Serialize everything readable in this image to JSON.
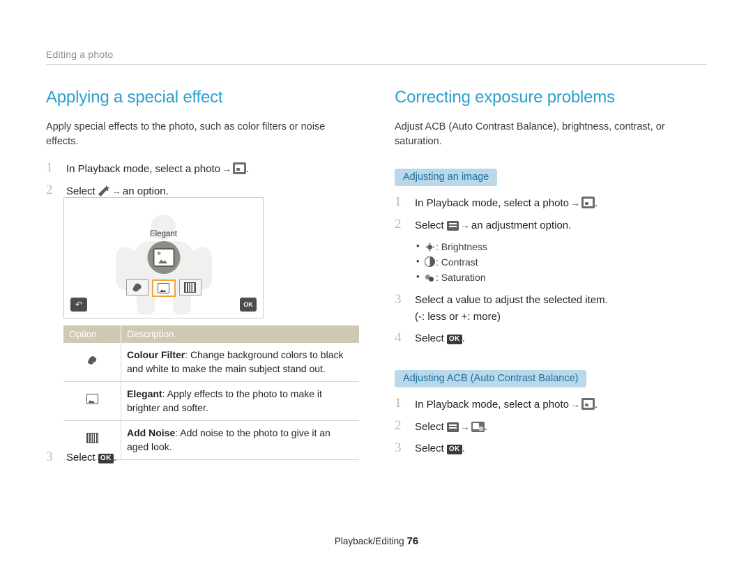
{
  "header": {
    "running_head": "Editing a photo"
  },
  "left": {
    "title": "Applying a special effect",
    "lead": "Apply special effects to the photo, such as color filters or noise effects.",
    "steps": [
      {
        "num": "1",
        "text_before": "In Playback mode, select a photo",
        "arrow": "→",
        "icon": "photo-edit-icon",
        "text_after": "."
      },
      {
        "num": "2",
        "text_before": "Select",
        "arrow": "→",
        "icon": "magic-wand-icon",
        "text_after": "an option."
      },
      {
        "num": "3",
        "text_before": "Select",
        "icon": "ok-button-icon",
        "text_after": "."
      }
    ],
    "screen": {
      "effect_label": "Elegant",
      "back_icon": "back-arrow-icon",
      "ok_icon": "ok-icon",
      "options": [
        "colour-filter-swatch",
        "elegant-swatch",
        "add-noise-swatch"
      ],
      "selected_index": 1
    },
    "table": {
      "headers": [
        "Option",
        "Description"
      ],
      "rows": [
        {
          "icon": "colour-filter-icon",
          "term": "Colour Filter",
          "desc": ": Change background colors to black and white to make the main subject stand out."
        },
        {
          "icon": "elegant-icon",
          "term": "Elegant",
          "desc": ": Apply effects to the photo to make it brighter and softer."
        },
        {
          "icon": "add-noise-icon",
          "term": "Add Noise",
          "desc": ": Add noise to the photo to give it an aged look."
        }
      ]
    }
  },
  "right": {
    "title": "Correcting exposure problems",
    "lead": "Adjust ACB (Auto Contrast Balance), brightness, contrast, or saturation.",
    "sub1": {
      "heading": "Adjusting an image",
      "steps": [
        {
          "num": "1",
          "text_before": "In Playback mode, select a photo",
          "arrow": "→",
          "icon": "photo-edit-icon",
          "text_after": "."
        },
        {
          "num": "2",
          "text_before": "Select",
          "arrow": "→",
          "icon": "adjust-icon",
          "text_after": "an adjustment option."
        },
        {
          "num": "3",
          "text_before": "Select a value to adjust the selected item.",
          "sub": "(-: less or +: more)"
        },
        {
          "num": "4",
          "text_before": "Select",
          "icon": "ok-button-icon",
          "text_after": "."
        }
      ],
      "bullets": [
        {
          "icon": "brightness-icon",
          "label": ": Brightness"
        },
        {
          "icon": "contrast-icon",
          "label": ": Contrast"
        },
        {
          "icon": "saturation-icon",
          "label": ": Saturation"
        }
      ]
    },
    "sub2": {
      "heading": "Adjusting ACB (Auto Contrast Balance)",
      "steps": [
        {
          "num": "1",
          "text_before": "In Playback mode, select a photo",
          "arrow": "→",
          "icon": "photo-edit-icon",
          "text_after": "."
        },
        {
          "num": "2",
          "text_before": "Select",
          "arrow": "→",
          "icon_a": "adjust-icon",
          "icon_b": "acb-icon",
          "text_after": "."
        },
        {
          "num": "3",
          "text_before": "Select",
          "icon": "ok-button-icon",
          "text_after": "."
        }
      ]
    }
  },
  "footer": {
    "label": "Playback/Editing",
    "page": "76"
  },
  "ok_label": "OK",
  "colors": {
    "heading": "#2d9fd0",
    "subhead_bg": "#b9d8ea",
    "subhead_text": "#1c6f9c",
    "table_header_bg": "#cfc9b3",
    "step_number": "#b9b9b9",
    "running_head": "#8c8c8c"
  }
}
